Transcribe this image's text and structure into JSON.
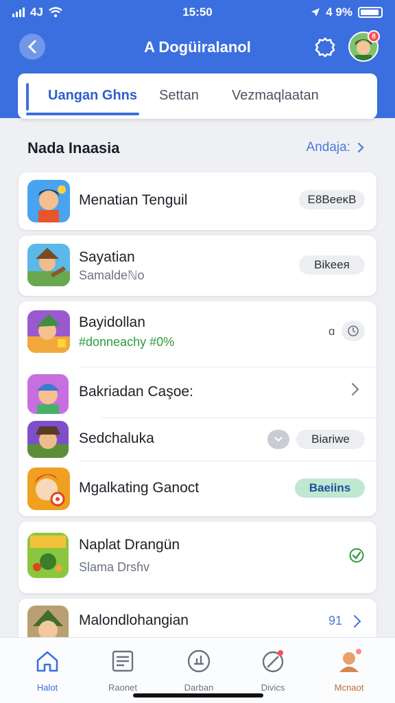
{
  "status": {
    "time": "15:50",
    "carrier": "4J",
    "battery": "4 9%"
  },
  "header": {
    "title": "A Dogüiralanol"
  },
  "tabs": [
    {
      "label": "Uangan Ghns",
      "active": true
    },
    {
      "label": "Settan"
    },
    {
      "label": "Vezmaqlaatan"
    }
  ],
  "section": {
    "title": "Nada Inaasia",
    "link": "Andaja:"
  },
  "games": [
    {
      "name": "Menatian Tenguil",
      "action": "E8BeeĸB"
    },
    {
      "name": "Sayatian",
      "sub": "Samaldeℕo",
      "action": "Bikeeя"
    },
    {
      "name": "Bayidollan",
      "sub": "#donneachy #0%",
      "action_icon": "clock-icon",
      "value": "ɑ"
    },
    {
      "name": "Bakriadan Caşoe:"
    },
    {
      "name": "Sedchaluka",
      "action": "Biariwe"
    },
    {
      "name": "Mgalkating Ganoct",
      "action": "Baeiins"
    },
    {
      "name": "Naplat Drangün",
      "sub": "Slama Drsɦv"
    },
    {
      "name": "Malondlohangian",
      "value": "91"
    }
  ],
  "nav": [
    {
      "label": "Halot",
      "icon": "home-icon",
      "active": true
    },
    {
      "label": "Raonet",
      "icon": "news-icon"
    },
    {
      "label": "Darban",
      "icon": "stats-icon"
    },
    {
      "label": "Divics",
      "icon": "compass-icon"
    },
    {
      "label": "Mcnaot",
      "icon": "profile-icon"
    }
  ],
  "colors": {
    "accent": "#3b6fe0",
    "success": "#2a9d3a"
  }
}
